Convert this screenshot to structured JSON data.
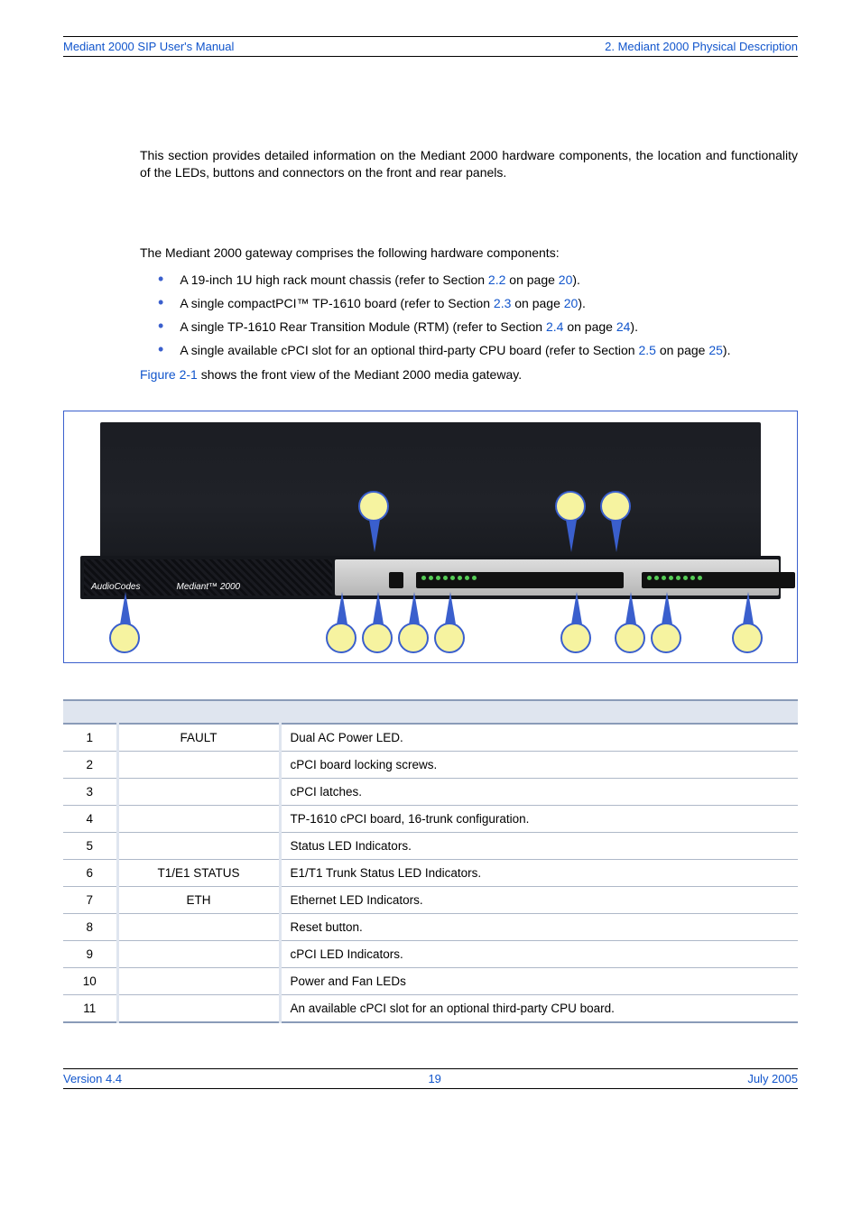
{
  "header": {
    "left": "Mediant 2000 SIP User's Manual",
    "right": "2. Mediant 2000 Physical Description"
  },
  "intro": "This section provides detailed information on the Mediant 2000 hardware components, the location and functionality of the LEDs, buttons and connectors on the front and rear panels.",
  "overview_lead": "The Mediant 2000 gateway comprises the following hardware components:",
  "bullets": {
    "b1_a": "A 19-inch 1U high rack mount chassis (refer to Section ",
    "b1_l1": "2.2",
    "b1_b": " on page ",
    "b1_l2": "20",
    "b1_c": ").",
    "b2_a": "A single compactPCI™ TP-1610 board (refer to Section ",
    "b2_l1": "2.3",
    "b2_b": " on page ",
    "b2_l2": "20",
    "b2_c": ").",
    "b3_a": "A single TP-1610 Rear Transition Module (RTM) (refer to Section ",
    "b3_l1": "2.4",
    "b3_b": " on page ",
    "b3_l2": "24",
    "b3_c": ").",
    "b4_a": "A single available cPCI slot for an optional third-party CPU board (refer to Section ",
    "b4_l1": "2.5",
    "b4_b": " on page ",
    "b4_l2": "25",
    "b4_c": ")."
  },
  "fig_ref": "Figure 2-1",
  "fig_ref_tail": " shows the front view of the Mediant 2000 media gateway.",
  "brand_a": "AudioCodes",
  "brand_b": "Mediant™ 2000",
  "table": {
    "rows": [
      {
        "n": "1",
        "label": "FAULT",
        "desc": "Dual AC Power LED."
      },
      {
        "n": "2",
        "label": "",
        "desc": "cPCI board locking screws."
      },
      {
        "n": "3",
        "label": "",
        "desc": "cPCI latches."
      },
      {
        "n": "4",
        "label": "",
        "desc": "TP-1610 cPCI board, 16-trunk configuration."
      },
      {
        "n": "5",
        "label": "",
        "desc": "Status LED Indicators."
      },
      {
        "n": "6",
        "label": "T1/E1 STATUS",
        "desc": "E1/T1 Trunk Status LED Indicators."
      },
      {
        "n": "7",
        "label": "ETH",
        "desc": "Ethernet LED Indicators."
      },
      {
        "n": "8",
        "label": "",
        "desc": "Reset button."
      },
      {
        "n": "9",
        "label": "",
        "desc": "cPCI LED Indicators."
      },
      {
        "n": "10",
        "label": "",
        "desc": "Power and Fan LEDs"
      },
      {
        "n": "11",
        "label": "",
        "desc": "An available cPCI slot for an optional third-party CPU board."
      }
    ]
  },
  "footer": {
    "left": "Version 4.4",
    "center": "19",
    "right": "July 2005"
  }
}
